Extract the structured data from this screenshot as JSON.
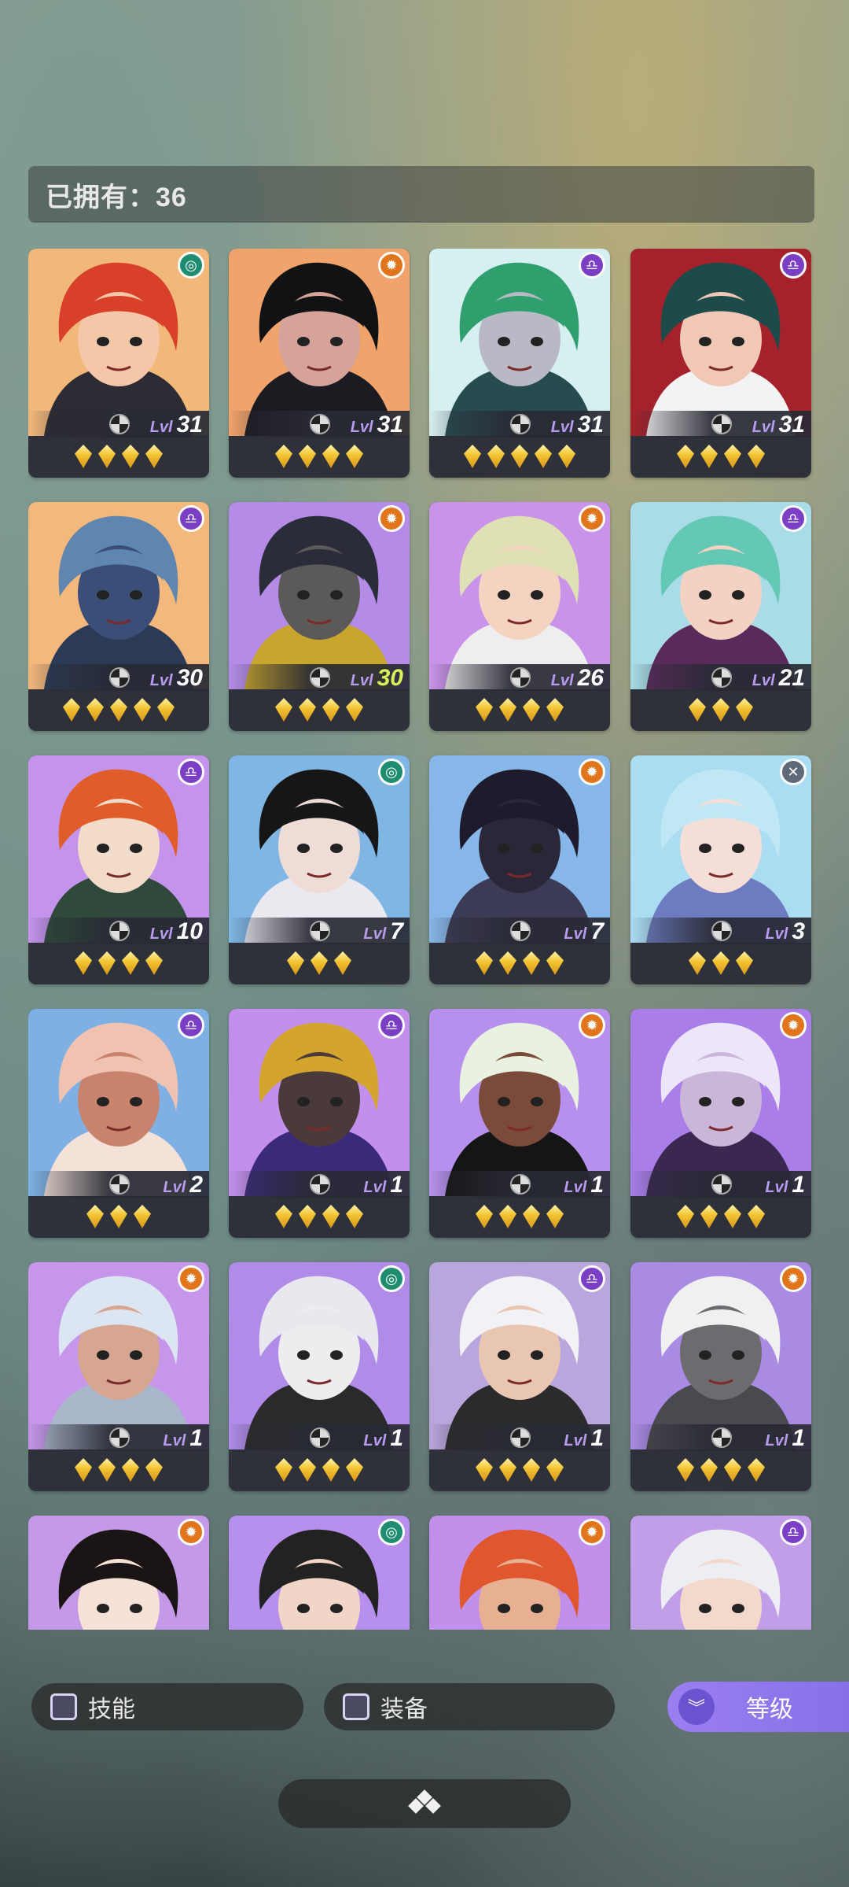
{
  "header": {
    "owned_label": "已拥有：36"
  },
  "level_prefix": "Lvl",
  "heroes": [
    {
      "level": "31",
      "stars": 4,
      "faction": "green-swirl-icon",
      "fcolor": "f-green",
      "bg": "#f2b87a",
      "hair": "#d8402a",
      "skin": "#f4c7a8",
      "outfit": "#2d2b33"
    },
    {
      "level": "31",
      "stars": 4,
      "faction": "orange-sun-icon",
      "fcolor": "f-orange",
      "bg": "#f0a36a",
      "hair": "#121214",
      "skin": "#d6a39a",
      "outfit": "#1d1b22"
    },
    {
      "level": "31",
      "stars": 5,
      "faction": "purple-mask-icon",
      "fcolor": "f-purple",
      "bg": "#d6eff0",
      "hair": "#2fa06d",
      "skin": "#b9b9c6",
      "outfit": "#274c4f"
    },
    {
      "level": "31",
      "stars": 4,
      "faction": "purple-mask-icon",
      "fcolor": "f-purple",
      "bg": "#a5222c",
      "hair": "#1c4b4a",
      "skin": "#f0c8b5",
      "outfit": "#f3f3f3"
    },
    {
      "level": "30",
      "stars": 5,
      "faction": "purple-mask-icon",
      "fcolor": "f-purple",
      "bg": "#f3b87c",
      "hair": "#5e86b0",
      "skin": "#3a4e77",
      "outfit": "#2b3a55"
    },
    {
      "level": "30",
      "stars": 4,
      "faction": "orange-sun-icon",
      "fcolor": "f-orange",
      "bg": "#b58be8",
      "hair": "#2a2c3a",
      "skin": "#5c5a58",
      "outfit": "#c8a52c",
      "green": true
    },
    {
      "level": "26",
      "stars": 4,
      "faction": "orange-sun-icon",
      "fcolor": "f-orange",
      "bg": "#c993ea",
      "hair": "#dfe0b3",
      "skin": "#f4d4c0",
      "outfit": "#eeeeee"
    },
    {
      "level": "21",
      "stars": 3,
      "faction": "purple-mask-icon",
      "fcolor": "f-purple",
      "bg": "#a9dce6",
      "hair": "#63c8b4",
      "skin": "#f3d2c4",
      "outfit": "#5a2b5a"
    },
    {
      "level": "10",
      "stars": 4,
      "faction": "purple-mask-icon",
      "fcolor": "f-purple",
      "bg": "#c494ec",
      "hair": "#e05d2a",
      "skin": "#f2dcc9",
      "outfit": "#2f4a3a"
    },
    {
      "level": "7",
      "stars": 3,
      "faction": "green-swirl-icon",
      "fcolor": "f-green",
      "bg": "#7fb6e4",
      "hair": "#161616",
      "skin": "#f0dcd6",
      "outfit": "#e9e9ef"
    },
    {
      "level": "7",
      "stars": 4,
      "faction": "orange-sun-icon",
      "fcolor": "f-orange",
      "bg": "#87b6e8",
      "hair": "#1d1b2c",
      "skin": "#2a2838",
      "outfit": "#3c3b55"
    },
    {
      "level": "3",
      "stars": 3,
      "faction": "gray-cross-icon",
      "fcolor": "f-gray",
      "bg": "#aadcf2",
      "hair": "#bfe8f4",
      "skin": "#f5ded8",
      "outfit": "#6d7cc0"
    },
    {
      "level": "2",
      "stars": 3,
      "faction": "purple-mask-icon",
      "fcolor": "f-purple",
      "bg": "#7eb0e4",
      "hair": "#f0c2b2",
      "skin": "#c9826c",
      "outfit": "#f4e2d8"
    },
    {
      "level": "1",
      "stars": 4,
      "faction": "purple-mask-icon",
      "fcolor": "f-purple",
      "bg": "#c290ec",
      "hair": "#d4a52c",
      "skin": "#4a3a3a",
      "outfit": "#3b2a7a"
    },
    {
      "level": "1",
      "stars": 4,
      "faction": "orange-sun-icon",
      "fcolor": "f-orange",
      "bg": "#b690ec",
      "hair": "#e9f2e0",
      "skin": "#7a4b3a",
      "outfit": "#151515"
    },
    {
      "level": "1",
      "stars": 4,
      "faction": "orange-sun-icon",
      "fcolor": "f-orange",
      "bg": "#a97ee8",
      "hair": "#ece6f8",
      "skin": "#c9b6d9",
      "outfit": "#3a2850"
    },
    {
      "level": "1",
      "stars": 4,
      "faction": "orange-sun-icon",
      "fcolor": "f-orange",
      "bg": "#c596ea",
      "hair": "#dce6f2",
      "skin": "#d6a690",
      "outfit": "#aab6c9"
    },
    {
      "level": "1",
      "stars": 4,
      "faction": "green-swirl-icon",
      "fcolor": "f-green",
      "bg": "#b08ce8",
      "hair": "#e8e8ee",
      "skin": "#ededf0",
      "outfit": "#2a2a2a"
    },
    {
      "level": "1",
      "stars": 4,
      "faction": "purple-mask-icon",
      "fcolor": "f-purple",
      "bg": "#b9a6dc",
      "hair": "#f2f2f6",
      "skin": "#e9c6b2",
      "outfit": "#2b2b2b"
    },
    {
      "level": "1",
      "stars": 4,
      "faction": "orange-sun-icon",
      "fcolor": "f-orange",
      "bg": "#a98be4",
      "hair": "#f0f0f0",
      "skin": "#6c6c70",
      "outfit": "#494a4f"
    },
    {
      "level": "",
      "stars": 0,
      "faction": "orange-sun-icon",
      "fcolor": "f-orange",
      "bg": "#c49ae8",
      "hair": "#1a1414",
      "skin": "#f6e2d6",
      "outfit": "#f0f0f0"
    },
    {
      "level": "",
      "stars": 0,
      "faction": "green-swirl-icon",
      "fcolor": "f-green",
      "bg": "#b690ec",
      "hair": "#222",
      "skin": "#f1d6c8",
      "outfit": "#f3f3f3"
    },
    {
      "level": "",
      "stars": 0,
      "faction": "orange-sun-icon",
      "fcolor": "f-orange",
      "bg": "#c090ea",
      "hair": "#e0562e",
      "skin": "#e8b093",
      "outfit": "#5a3a2a"
    },
    {
      "level": "",
      "stars": 0,
      "faction": "purple-mask-icon",
      "fcolor": "f-purple",
      "bg": "#c29ee8",
      "hair": "#ededf4",
      "skin": "#f3d9cc",
      "outfit": "#ededf4"
    }
  ],
  "filters": {
    "skill_label": "技能",
    "equipment_label": "装备",
    "sort_label": "等级"
  },
  "collapse_icon": "collapse-diamond-icon"
}
